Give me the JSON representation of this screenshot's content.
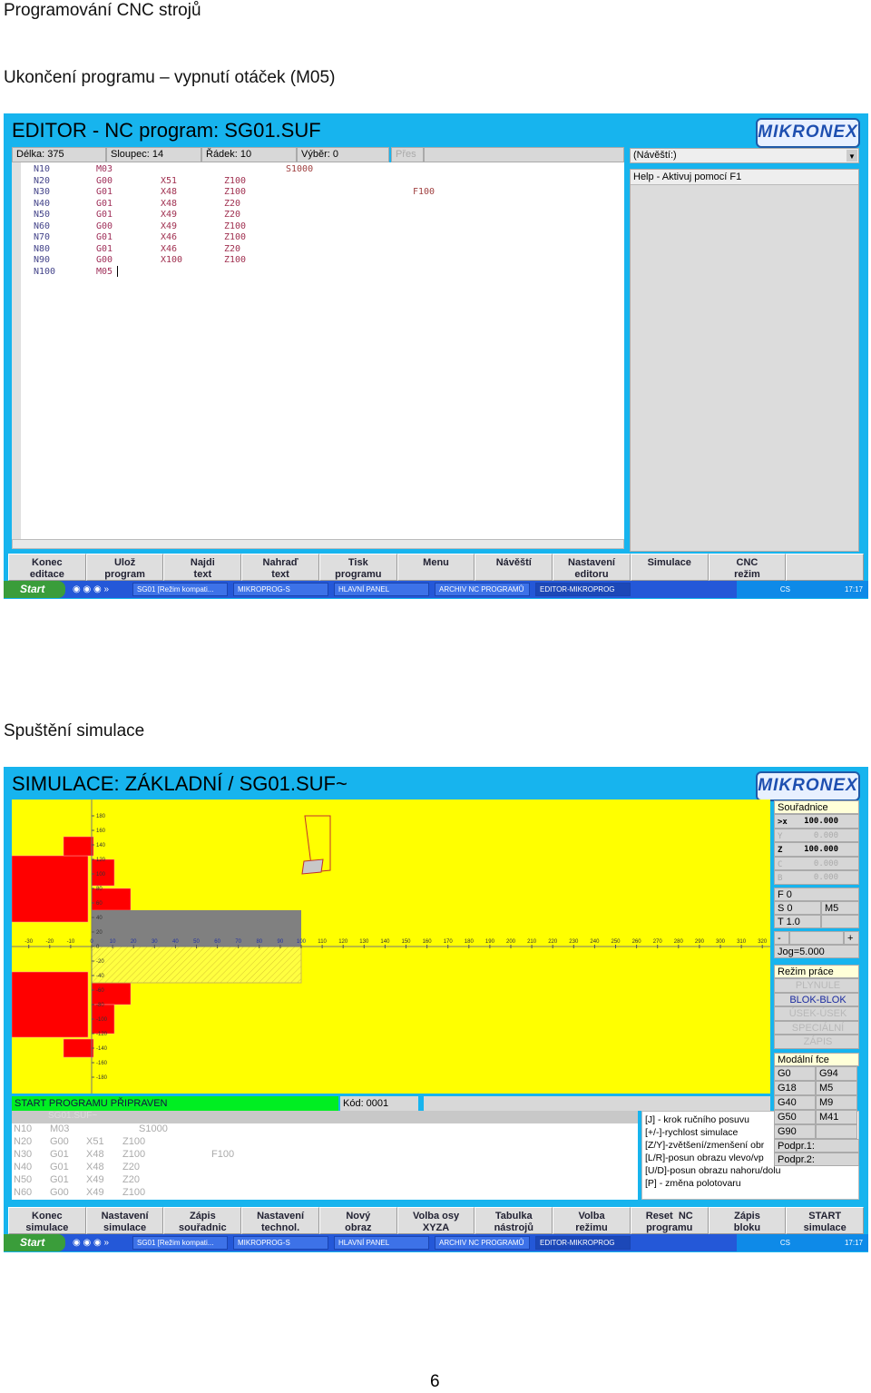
{
  "page": {
    "header": "Programování CNC strojů",
    "section1": "Ukončení programu – vypnutí otáček (M05)",
    "section2": "Spuštění simulace",
    "page_number": "6"
  },
  "logo": "MIKRONEX",
  "taskbar": {
    "start": "Start",
    "items": [
      "SG01 [Režim kompati...",
      "MIKROPROG-S",
      "HLAVNÍ PANEL",
      "ARCHIV NC PROGRAMŮ",
      "EDITOR-MIKROPROG"
    ],
    "lang": "CS",
    "time": "17:17"
  },
  "editor": {
    "title": "EDITOR - NC program: SG01.SUF",
    "status": {
      "length": "Délka: 375",
      "column": "Sloupec: 14",
      "row": "Řádek: 10",
      "selection": "Výběr: 0",
      "mode": "Přes"
    },
    "lines": [
      [
        "N10",
        "M03",
        "",
        "",
        "S1000",
        ""
      ],
      [
        "N20",
        "G00",
        "X51",
        "Z100",
        "",
        ""
      ],
      [
        "N30",
        "G01",
        "X48",
        "Z100",
        "",
        "F100"
      ],
      [
        "N40",
        "G01",
        "X48",
        "Z20",
        "",
        ""
      ],
      [
        "N50",
        "G01",
        "X49",
        "Z20",
        "",
        ""
      ],
      [
        "N60",
        "G00",
        "X49",
        "Z100",
        "",
        ""
      ],
      [
        "N70",
        "G01",
        "X46",
        "Z100",
        "",
        ""
      ],
      [
        "N80",
        "G01",
        "X46",
        "Z20",
        "",
        ""
      ],
      [
        "N90",
        "G00",
        "X100",
        "Z100",
        "",
        ""
      ],
      [
        "N100",
        "M05",
        "",
        "",
        "",
        ""
      ]
    ],
    "label_dropdown": "(Návěští:)",
    "help": "Help - Aktivuj pomocí F1",
    "buttons": [
      "Konec\neditace",
      "Ulož\nprogram",
      "Najdi\ntext",
      "Nahraď\ntext",
      "Tisk\nprogramu",
      "Menu",
      "Návěští",
      "Nastavení\neditoru",
      "Simulace",
      "CNC\nrežim",
      ""
    ]
  },
  "simulation": {
    "title": "SIMULACE: ZÁKLADNÍ / SG01.SUF~",
    "x_ticks": [
      -30,
      -20,
      -10,
      0,
      10,
      20,
      30,
      40,
      50,
      60,
      70,
      80,
      90,
      100,
      110,
      120,
      130,
      140,
      150,
      160,
      170,
      180,
      190,
      200,
      210,
      220,
      230,
      240,
      250,
      260,
      270,
      280,
      290,
      300,
      310,
      320
    ],
    "y_ticks": [
      180,
      160,
      140,
      120,
      100,
      80,
      60,
      40,
      20,
      0,
      -20,
      -40,
      -60,
      -80,
      -100,
      -120,
      -140,
      -160,
      -180
    ],
    "status": "START PROGRAMU PŘIPRAVEN",
    "code_label": "Kód: 0001",
    "file_label": "SG01.SUF~",
    "lines": [
      [
        "N10",
        "M03",
        "",
        "",
        "S1000",
        ""
      ],
      [
        "N20",
        "G00",
        "X51",
        "Z100",
        "",
        ""
      ],
      [
        "N30",
        "G01",
        "X48",
        "Z100",
        "",
        "F100"
      ],
      [
        "N40",
        "G01",
        "X48",
        "Z20",
        "",
        ""
      ],
      [
        "N50",
        "G01",
        "X49",
        "Z20",
        "",
        ""
      ],
      [
        "N60",
        "G00",
        "X49",
        "Z100",
        "",
        ""
      ]
    ],
    "keys": [
      "[J] - krok ručního posuvu",
      "[+/-]-rychlost simulace",
      "[Z/Y]-zvětšení/zmenšení obr",
      "[L/R]-posun obrazu vlevo/vp",
      "[U/D]-posun obrazu nahoru/dolu",
      "[P] - změna polotovaru"
    ],
    "coords": {
      "title": "Souřadnice",
      "rows": [
        [
          ">x",
          "100.000"
        ],
        [
          "Y",
          "0.000"
        ],
        [
          "Z",
          "100.000"
        ],
        [
          "C",
          "0.000"
        ],
        [
          "B",
          "0.000"
        ]
      ]
    },
    "feed": "F 0",
    "spindle": "S 0",
    "spindle_m": "M5",
    "tool": "T 1.0",
    "jog_minus": "-",
    "jog_plus": "+",
    "jog": "Jog=5.000",
    "mode": {
      "title": "Režim práce",
      "items": [
        "PLYNULE",
        "BLOK-BLOK",
        "ÚSEK-ÚSEK",
        "SPECIÁLNÍ",
        "ZÁPIS"
      ],
      "active": "BLOK-BLOK"
    },
    "modal": {
      "title": "Modální fce",
      "rows": [
        [
          "G0",
          "G94"
        ],
        [
          "G18",
          "M5"
        ],
        [
          "G40",
          "M9"
        ],
        [
          "G50",
          "M41"
        ],
        [
          "G90",
          ""
        ]
      ],
      "sub1": "Podpr.1:",
      "sub2": "Podpr.2:"
    },
    "buttons": [
      "Konec\nsimulace",
      "Nastavení\nsimulace",
      "Zápis\nsouřadnic",
      "Nastavení\ntechnol.",
      "Nový\nobraz",
      "Volba osy\nXYZA",
      "Tabulka\nnástrojů",
      "Volba\nrežimu",
      "Reset  NC\nprogramu",
      "Zápis\nbloku",
      "START\nsimulace"
    ],
    "colors": {
      "background": "#ffff00",
      "chuck": "#ff0000",
      "workpiece": "#808080",
      "status_ok": "#00ee22"
    }
  }
}
